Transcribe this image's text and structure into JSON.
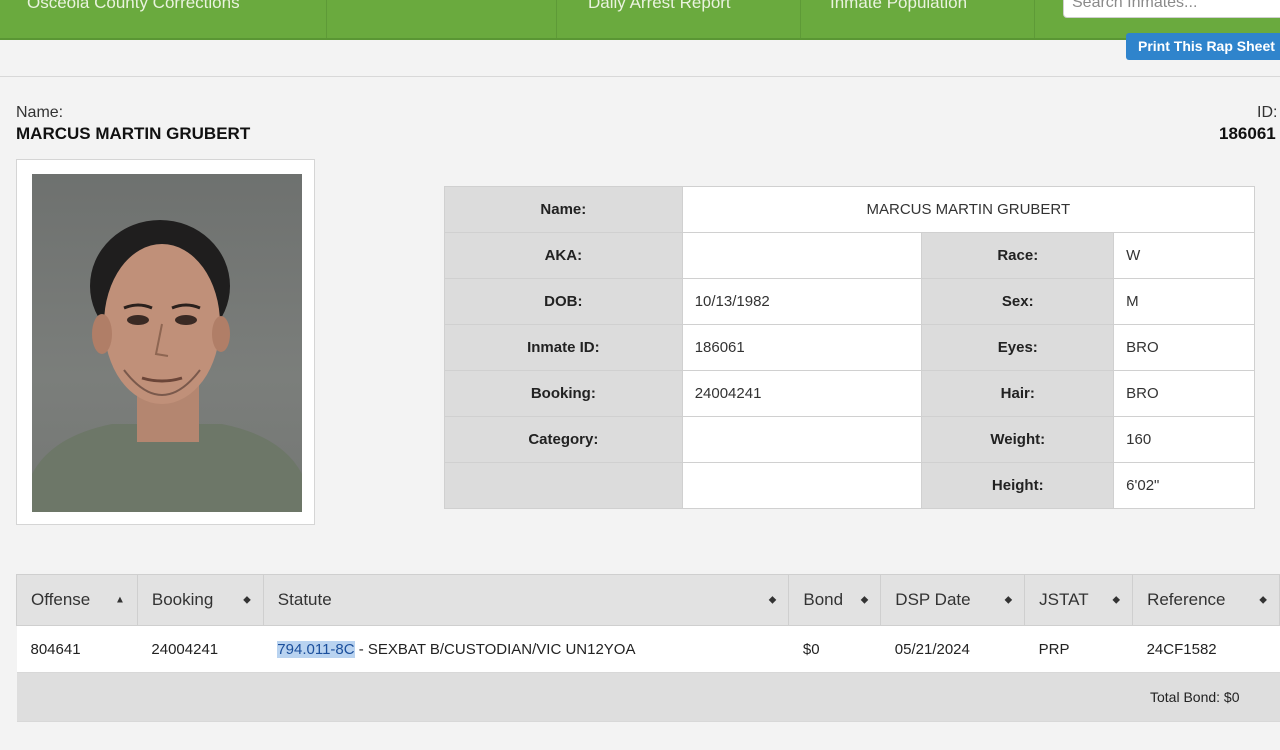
{
  "nav": {
    "brand": "Osceola County Corrections",
    "links": [
      "Daily Arrest Report",
      "Inmate Population"
    ],
    "search_placeholder": "Search Inmates..."
  },
  "print_button": "Print This Rap Sheet",
  "header": {
    "name_label": "Name:",
    "name": "MARCUS MARTIN GRUBERT",
    "id_label": "ID:",
    "id": "186061"
  },
  "info": {
    "name_label": "Name:",
    "name": "MARCUS MARTIN GRUBERT",
    "aka_label": "AKA:",
    "aka": "",
    "race_label": "Race:",
    "race": "W",
    "dob_label": "DOB:",
    "dob": "10/13/1982",
    "sex_label": "Sex:",
    "sex": "M",
    "inmate_id_label": "Inmate ID:",
    "inmate_id": "186061",
    "eyes_label": "Eyes:",
    "eyes": "BRO",
    "booking_label": "Booking:",
    "booking": "24004241",
    "hair_label": "Hair:",
    "hair": "BRO",
    "category_label": "Category:",
    "category": "",
    "weight_label": "Weight:",
    "weight": "160",
    "height_label": "Height:",
    "height": "6'02\""
  },
  "offenses": {
    "columns": [
      "Offense",
      "Booking",
      "Statute",
      "Bond",
      "DSP Date",
      "JSTAT",
      "Reference"
    ],
    "rows": [
      {
        "offense": "804641",
        "booking": "24004241",
        "statute_code": "794.011-8C",
        "statute_desc": " - SEXBAT B/CUSTODIAN/VIC UN12YOA",
        "bond": "$0",
        "dsp_date": "05/21/2024",
        "jstat": "PRP",
        "reference": "24CF1582"
      }
    ],
    "total_bond": "Total Bond: $0"
  },
  "colors": {
    "nav": "#6aaa3e",
    "button": "#2f84cc"
  }
}
